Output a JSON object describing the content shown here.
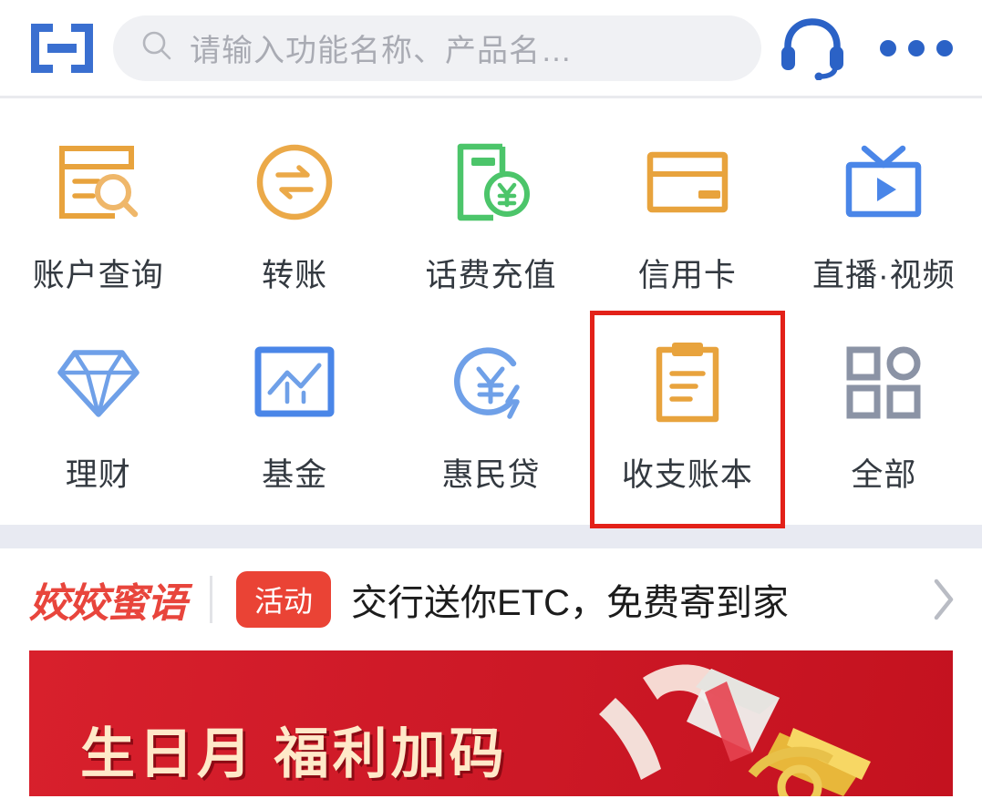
{
  "header": {
    "logo_name": "bank-bracket-logo",
    "search": {
      "placeholder": "请输入功能名称、产品名…",
      "icon": "search-icon"
    },
    "service_icon": "headset-icon",
    "more_icon": "more-dots-icon"
  },
  "grid": {
    "rows": [
      [
        {
          "label": "账户查询",
          "icon": "account-query-icon",
          "color": "#e8a33d",
          "highlighted": false
        },
        {
          "label": "转账",
          "icon": "transfer-icon",
          "color": "#e8a33d",
          "highlighted": false
        },
        {
          "label": "话费充值",
          "icon": "phone-recharge-icon",
          "color": "#4cc56a",
          "highlighted": false
        },
        {
          "label": "信用卡",
          "icon": "credit-card-icon",
          "color": "#e8a33d",
          "highlighted": false
        },
        {
          "label": "直播·视频",
          "icon": "live-video-icon",
          "color": "#4a86e8",
          "highlighted": false
        }
      ],
      [
        {
          "label": "理财",
          "icon": "wealth-diamond-icon",
          "color": "#6fa0e8",
          "highlighted": false
        },
        {
          "label": "基金",
          "icon": "fund-chart-icon",
          "color": "#4a86e8",
          "highlighted": false
        },
        {
          "label": "惠民贷",
          "icon": "loan-yuan-icon",
          "color": "#6fa0e8",
          "highlighted": false
        },
        {
          "label": "收支账本",
          "icon": "ledger-clipboard-icon",
          "color": "#e8a33d",
          "highlighted": true
        },
        {
          "label": "全部",
          "icon": "all-apps-icon",
          "color": "#8b93a5",
          "highlighted": false
        }
      ]
    ],
    "highlight_color": "#e32119"
  },
  "promo": {
    "brand": "姣姣蜜语",
    "badge": "活动",
    "text": "交行送你ETC，免费寄到家",
    "chevron_icon": "chevron-right-icon",
    "brand_color": "#e8453c",
    "badge_color": "#ea4335"
  },
  "banner": {
    "title": "生日月 福利加码",
    "background_color": "#cf1a28",
    "title_color": "#ffe9c9"
  }
}
